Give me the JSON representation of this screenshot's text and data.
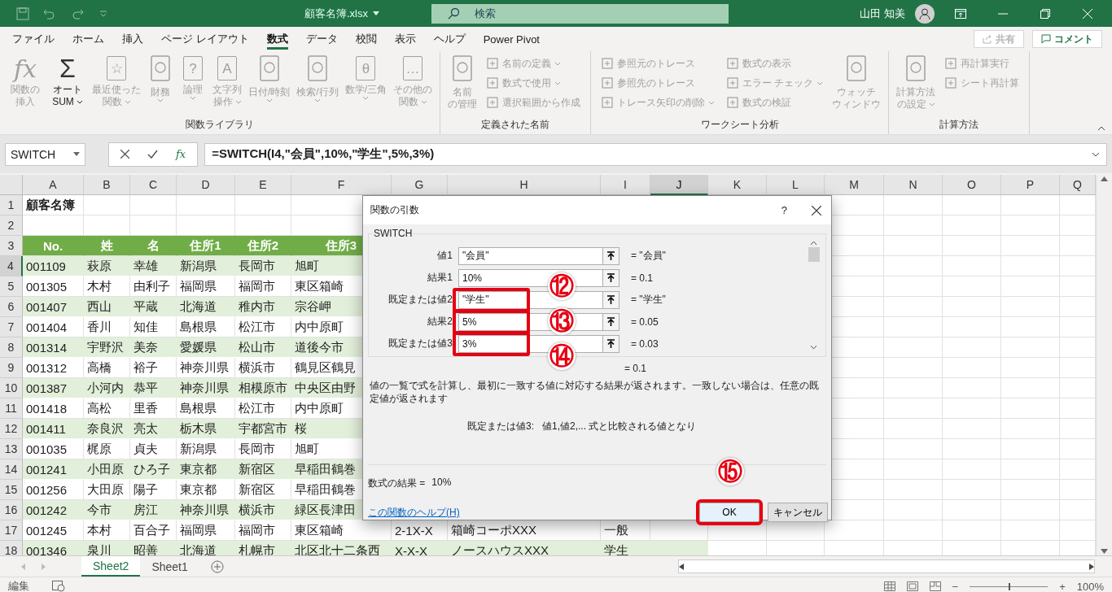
{
  "title_bar": {
    "filename": "顧客名簿.xlsx",
    "search_placeholder": "検索",
    "user": "山田 知美"
  },
  "menu_tabs": [
    {
      "label": "ファイル",
      "selected": false
    },
    {
      "label": "ホーム",
      "selected": false
    },
    {
      "label": "挿入",
      "selected": false
    },
    {
      "label": "ページ レイアウト",
      "selected": false
    },
    {
      "label": "数式",
      "selected": true
    },
    {
      "label": "データ",
      "selected": false
    },
    {
      "label": "校閲",
      "selected": false
    },
    {
      "label": "表示",
      "selected": false
    },
    {
      "label": "ヘルプ",
      "selected": false
    },
    {
      "label": "Power Pivot",
      "selected": false
    }
  ],
  "share_button": {
    "label": "共有",
    "disabled": true
  },
  "comment_button": {
    "label": "コメント"
  },
  "ribbon_groups": [
    {
      "title": "関数ライブラリ",
      "items": [
        {
          "kind": "large",
          "label_lines": [
            "関数の",
            "挿入"
          ],
          "glyph": "fx",
          "disabled": true,
          "dropdown": false
        },
        {
          "kind": "large",
          "label_lines": [
            "オート",
            "SUM"
          ],
          "glyph": "Σ",
          "disabled": false,
          "dropdown": true
        },
        {
          "kind": "large",
          "label_lines": [
            "最近使った",
            "関数"
          ],
          "glyph": "☆",
          "disabled": true,
          "dropdown": true
        },
        {
          "kind": "large",
          "label_lines": [
            "財務"
          ],
          "disabled": true,
          "dropdown": true
        },
        {
          "kind": "large",
          "label_lines": [
            "論理"
          ],
          "glyph": "?",
          "disabled": true,
          "dropdown": true
        },
        {
          "kind": "large",
          "label_lines": [
            "文字列",
            "操作"
          ],
          "glyph": "A",
          "disabled": true,
          "dropdown": true
        },
        {
          "kind": "large",
          "label_lines": [
            "日付/時刻"
          ],
          "disabled": true,
          "dropdown": true
        },
        {
          "kind": "large",
          "label_lines": [
            "検索/行列"
          ],
          "disabled": true,
          "dropdown": true
        },
        {
          "kind": "large",
          "label_lines": [
            "数学/三角"
          ],
          "glyph": "θ",
          "disabled": true,
          "dropdown": true
        },
        {
          "kind": "large",
          "label_lines": [
            "その他の",
            "関数"
          ],
          "glyph": "…",
          "disabled": true,
          "dropdown": true
        }
      ]
    },
    {
      "title": "定義された名前",
      "items": [
        {
          "kind": "large",
          "label_lines": [
            "名前",
            "の管理"
          ],
          "disabled": true,
          "dropdown": false
        },
        {
          "kind": "small",
          "label": "名前の定義",
          "disabled": true,
          "dropdown": true
        },
        {
          "kind": "small",
          "label": "数式で使用",
          "disabled": true,
          "dropdown": true
        },
        {
          "kind": "small",
          "label": "選択範囲から作成",
          "disabled": true,
          "dropdown": false
        }
      ]
    },
    {
      "title": "ワークシート分析",
      "items": [
        {
          "kind": "small",
          "label": "参照元のトレース",
          "disabled": true,
          "dropdown": false
        },
        {
          "kind": "small",
          "label": "参照先のトレース",
          "disabled": true,
          "dropdown": false
        },
        {
          "kind": "small",
          "label": "トレース矢印の削除",
          "disabled": true,
          "dropdown": true
        },
        {
          "kind": "small",
          "label": "数式の表示",
          "disabled": true,
          "dropdown": false
        },
        {
          "kind": "small",
          "label": "エラー チェック",
          "disabled": true,
          "dropdown": true
        },
        {
          "kind": "small",
          "label": "数式の検証",
          "disabled": true,
          "dropdown": false
        },
        {
          "kind": "large",
          "label_lines": [
            "ウォッチ",
            "ウィンドウ"
          ],
          "disabled": true,
          "dropdown": false
        }
      ]
    },
    {
      "title": "計算方法",
      "items": [
        {
          "kind": "large",
          "label_lines": [
            "計算方法",
            "の設定"
          ],
          "disabled": true,
          "dropdown": true
        },
        {
          "kind": "small",
          "label": "再計算実行",
          "disabled": true,
          "dropdown": false
        },
        {
          "kind": "small",
          "label": "シート再計算",
          "disabled": true,
          "dropdown": false
        }
      ]
    }
  ],
  "formula_bar": {
    "name_box": "SWITCH",
    "function_label": "fx",
    "formula": "=SWITCH(I4,\"会員\",10%,\"学生\",5%,3%)"
  },
  "sheet": {
    "columns": [
      {
        "label": "A",
        "selected": false
      },
      {
        "label": "B",
        "selected": false
      },
      {
        "label": "C",
        "selected": false
      },
      {
        "label": "D",
        "selected": false
      },
      {
        "label": "E",
        "selected": false
      },
      {
        "label": "F",
        "selected": false
      },
      {
        "label": "G",
        "selected": false
      },
      {
        "label": "H",
        "selected": false
      },
      {
        "label": "I",
        "selected": false
      },
      {
        "label": "J",
        "selected": true
      },
      {
        "label": "K",
        "selected": false
      },
      {
        "label": "L",
        "selected": false
      },
      {
        "label": "M",
        "selected": false
      },
      {
        "label": "N",
        "selected": false
      },
      {
        "label": "O",
        "selected": false
      },
      {
        "label": "P",
        "selected": false
      },
      {
        "label": "Q",
        "selected": false
      }
    ],
    "rows": [
      {
        "number": "1",
        "kind": "title",
        "selected": false,
        "cells": [
          "顧客名簿"
        ]
      },
      {
        "number": "2",
        "kind": "blank",
        "selected": false,
        "cells": []
      },
      {
        "number": "3",
        "kind": "header",
        "selected": false,
        "cells": [
          "No.",
          "姓",
          "名",
          "住所1",
          "住所2",
          "住所3"
        ]
      },
      {
        "number": "4",
        "kind": "data",
        "selected": true,
        "cells": [
          "001109",
          "萩原",
          "幸雄",
          "新潟県",
          "長岡市",
          "旭町"
        ]
      },
      {
        "number": "5",
        "kind": "data",
        "selected": false,
        "cells": [
          "001305",
          "木村",
          "由利子",
          "福岡県",
          "福岡市",
          "東区箱崎"
        ]
      },
      {
        "number": "6",
        "kind": "data",
        "selected": false,
        "cells": [
          "001407",
          "西山",
          "平蔵",
          "北海道",
          "稚内市",
          "宗谷岬"
        ]
      },
      {
        "number": "7",
        "kind": "data",
        "selected": false,
        "cells": [
          "001404",
          "香川",
          "知佳",
          "島根県",
          "松江市",
          "内中原町"
        ]
      },
      {
        "number": "8",
        "kind": "data",
        "selected": false,
        "cells": [
          "001314",
          "宇野沢",
          "美奈",
          "愛媛県",
          "松山市",
          "道後今市"
        ]
      },
      {
        "number": "9",
        "kind": "data",
        "selected": false,
        "cells": [
          "001312",
          "高橋",
          "裕子",
          "神奈川県",
          "横浜市",
          "鶴見区鶴見"
        ]
      },
      {
        "number": "10",
        "kind": "data",
        "selected": false,
        "cells": [
          "001387",
          "小河内",
          "恭平",
          "神奈川県",
          "相模原市",
          "中央区由野"
        ]
      },
      {
        "number": "11",
        "kind": "data",
        "selected": false,
        "cells": [
          "001418",
          "高松",
          "里香",
          "島根県",
          "松江市",
          "内中原町"
        ]
      },
      {
        "number": "12",
        "kind": "data",
        "selected": false,
        "cells": [
          "001411",
          "奈良沢",
          "亮太",
          "栃木県",
          "宇都宮市",
          "桜"
        ]
      },
      {
        "number": "13",
        "kind": "data",
        "selected": false,
        "cells": [
          "001035",
          "梶原",
          "貞夫",
          "新潟県",
          "長岡市",
          "旭町"
        ]
      },
      {
        "number": "14",
        "kind": "data",
        "selected": false,
        "cells": [
          "001241",
          "小田原",
          "ひろ子",
          "東京都",
          "新宿区",
          "早稲田鶴巻"
        ]
      },
      {
        "number": "15",
        "kind": "data",
        "selected": false,
        "cells": [
          "001256",
          "大田原",
          "陽子",
          "東京都",
          "新宿区",
          "早稲田鶴巻"
        ]
      },
      {
        "number": "16",
        "kind": "data",
        "selected": false,
        "cells": [
          "001242",
          "今市",
          "房江",
          "神奈川県",
          "横浜市",
          "緑区長津田"
        ]
      },
      {
        "number": "17",
        "kind": "data",
        "selected": false,
        "cells": [
          "001245",
          "本村",
          "百合子",
          "福岡県",
          "福岡市",
          "東区箱崎",
          "2-1X-X",
          "箱崎コーポXXX",
          "一般"
        ]
      },
      {
        "number": "18",
        "kind": "data",
        "selected": false,
        "cells": [
          "001346",
          "泉川",
          "昭善",
          "北海道",
          "札幌市",
          "北区北十二条西",
          "X-X-X",
          "ノースハウスXXX",
          "学生"
        ]
      }
    ]
  },
  "sheet_tabs": [
    {
      "label": "Sheet2",
      "selected": true
    },
    {
      "label": "Sheet1",
      "selected": false
    }
  ],
  "status_bar": {
    "mode": "編集",
    "zoom_minus": "−",
    "zoom_plus": "+",
    "zoom": "100%",
    "level": 0.5
  },
  "dialog": {
    "title": "関数の引数",
    "help_glyph": "?",
    "function_name": "SWITCH",
    "arguments": [
      {
        "label": "値1",
        "value": "\"会員\"",
        "result": "= \"会員\"",
        "highlighted": false
      },
      {
        "label": "結果1",
        "value": "10%",
        "result": "= 0.1",
        "highlighted": false
      },
      {
        "label": "既定または値2",
        "value": "\"学生\"",
        "result": "= \"学生\"",
        "highlighted": true,
        "callout": "⑫"
      },
      {
        "label": "結果2",
        "value": "5%",
        "result": "= 0.05",
        "highlighted": true,
        "callout": "⑬"
      },
      {
        "label": "既定または値3",
        "value": "3%",
        "result": "= 0.03",
        "highlighted": true,
        "callout": "⑭"
      }
    ],
    "total_result": "= 0.1",
    "description": "値の一覧で式を計算し、最初に一致する値に対応する結果が返されます。一致しない場合は、任意の既定値が返されます",
    "argument_help_label": "既定または値3:",
    "argument_help": "値1,値2,... 式と比較される値となり",
    "formula_result_label": "数式の結果 =",
    "formula_result": "10%",
    "help_link": "この関数のヘルプ(H)",
    "buttons": [
      {
        "label": "OK",
        "highlighted": true,
        "callout": "⑮"
      },
      {
        "label": "キャンセル",
        "highlighted": false
      }
    ]
  }
}
